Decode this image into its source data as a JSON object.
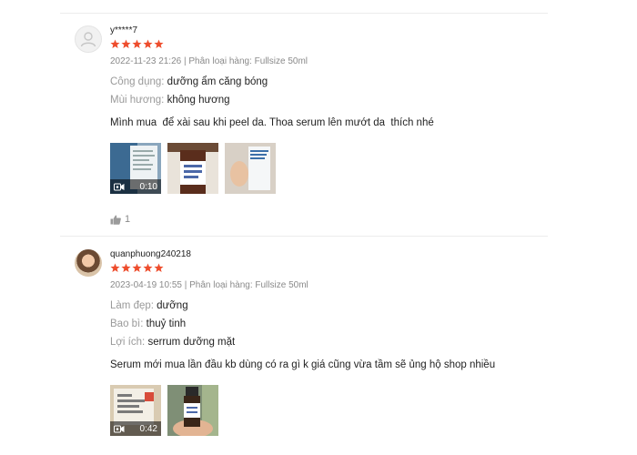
{
  "reviews": [
    {
      "username": "y*****7",
      "rating": 5,
      "meta": "2022-11-23 21:26 | Phân loại hàng: Fullsize 50ml",
      "attributes": [
        {
          "key": "Công dụng:",
          "value": "dưỡng ẩm căng bóng"
        },
        {
          "key": "Mùi hương:",
          "value": "không hương"
        }
      ],
      "comment": "Mình mua  để xài sau khi peel da. Thoa serum lên mướt da  thích nhé",
      "video_duration": "0:10",
      "likes": "1"
    },
    {
      "username": "quanphuong240218",
      "rating": 5,
      "meta": "2023-04-19 10:55 | Phân loại hàng: Fullsize 50ml",
      "attributes": [
        {
          "key": "Làm đẹp:",
          "value": "dưỡng"
        },
        {
          "key": "Bao bì:",
          "value": "thuỷ tinh"
        },
        {
          "key": "Lợi ích:",
          "value": "serrum dưỡng mặt"
        }
      ],
      "comment": "Serum mới mua lần đầu kb dùng có ra gì k giá cũng vừa tầm sẽ ủng hộ shop nhiều",
      "video_duration": "0:42"
    }
  ],
  "colors": {
    "star": "#ee4d2d",
    "muted": "#8a8a8a"
  },
  "icons": {
    "avatar_placeholder": "user-icon",
    "star": "star-icon",
    "video": "video-camera-icon",
    "like": "thumbs-up-icon"
  }
}
